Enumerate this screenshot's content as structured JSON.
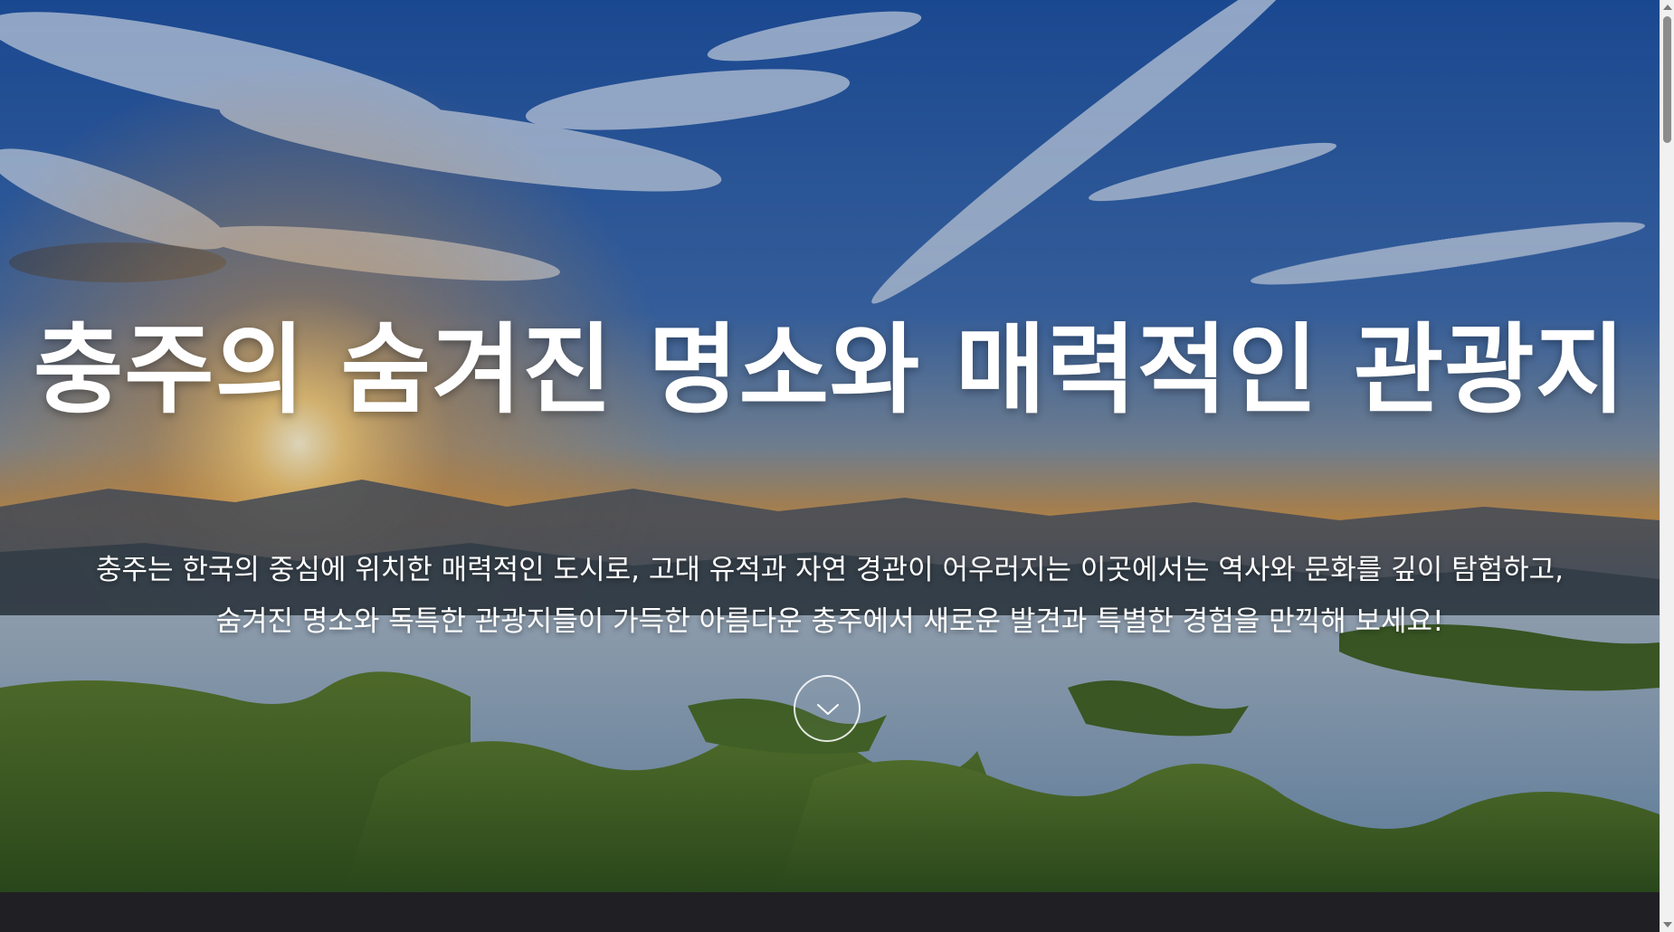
{
  "hero": {
    "title": "충주의 숨겨진 명소와 매력적인 관광지",
    "description_lines": [
      "충주는 한국의 중심에 위치한 매력적인 도시로, 고대 유적과 자연 경관이 어우러지는 이곳에서는 역사와 문화를 깊이 탐험하고,",
      "숨겨진 명소와 독특한 관광지들이 가득한 아름다운 충주에서 새로운 발견과 특별한 경험을 만끽해 보세요!"
    ],
    "scroll_button_icon": "chevron-down-icon"
  },
  "colors": {
    "sky_top": "#1d4f9c",
    "sky_mid": "#4a78b8",
    "sunset": "#e9a33a",
    "mountains": "#3a4a5a",
    "lake": "#7c92ab",
    "forest": "#2f5a22",
    "footer": "#1f1f24",
    "text": "#ffffff"
  }
}
